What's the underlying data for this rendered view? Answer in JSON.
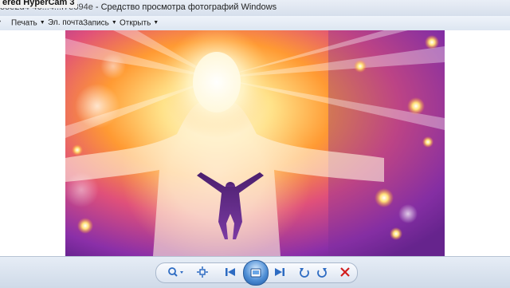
{
  "window": {
    "watermark": "ered HyperCam 3",
    "filename_prefix": "o5e2d4-46...4...f7e894e",
    "title": "- Средство просмотра фотографий Windows"
  },
  "menu": {
    "items": [
      {
        "label": "Печать",
        "has_dropdown": true
      },
      {
        "label": "Эл. почта",
        "has_dropdown": false
      },
      {
        "label": "Запись",
        "has_dropdown": true
      },
      {
        "label": "Открыть",
        "has_dropdown": true
      }
    ]
  },
  "controls": {
    "icons": [
      "zoom-icon",
      "actual-size-icon",
      "previous-icon",
      "slideshow-icon",
      "next-icon",
      "rotate-left-icon",
      "rotate-right-icon",
      "delete-icon"
    ]
  },
  "colors": {
    "accent": "#2d6bc2",
    "delete": "#d21e1e",
    "photo_purple": "#7a2d9c",
    "photo_orange": "#ff9a33"
  }
}
